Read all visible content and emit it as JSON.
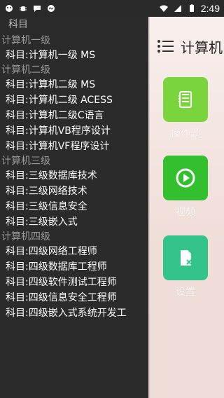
{
  "status_bar": {
    "time": "2:49",
    "left_icons": [
      "android-icon",
      "bug-icon",
      "chat-icon",
      "messenger-icon"
    ],
    "right_icons": [
      "wifi-icon",
      "signal-icon",
      "battery-icon"
    ]
  },
  "app": {
    "title": "计算机"
  },
  "tiles": [
    {
      "label": "操作题",
      "icon": "notebook-icon",
      "color": "#7ad53d"
    },
    {
      "label": "视频",
      "icon": "play-icon",
      "color": "#32c02f"
    },
    {
      "label": "设置",
      "icon": "file-x-icon",
      "color": "#33c48a"
    }
  ],
  "drawer": {
    "header": "科目",
    "groups": [
      {
        "title": "计算机一级",
        "items": [
          "科目:计算机一级 MS"
        ]
      },
      {
        "title": "计算机二级",
        "items": [
          "科目:计算机二级 MS",
          "科目:计算机二级 ACESS",
          "科目:计算机二级C语言",
          "科目:计算机VB程序设计",
          "科目:计算机VF程序设计"
        ]
      },
      {
        "title": "计算机三级",
        "items": [
          "科目:三级数据库技术",
          "科目:三级网络技术",
          "科目:三级信息安全",
          "科目:三级嵌入式"
        ]
      },
      {
        "title": "计算机四级",
        "items": [
          "科目:四级网络工程师",
          "科目:四级数据库工程师",
          "科目:四级软件测试工程师",
          "科目:四级信息安全工程师",
          "科目:四级嵌入式系统开发工"
        ]
      }
    ]
  }
}
